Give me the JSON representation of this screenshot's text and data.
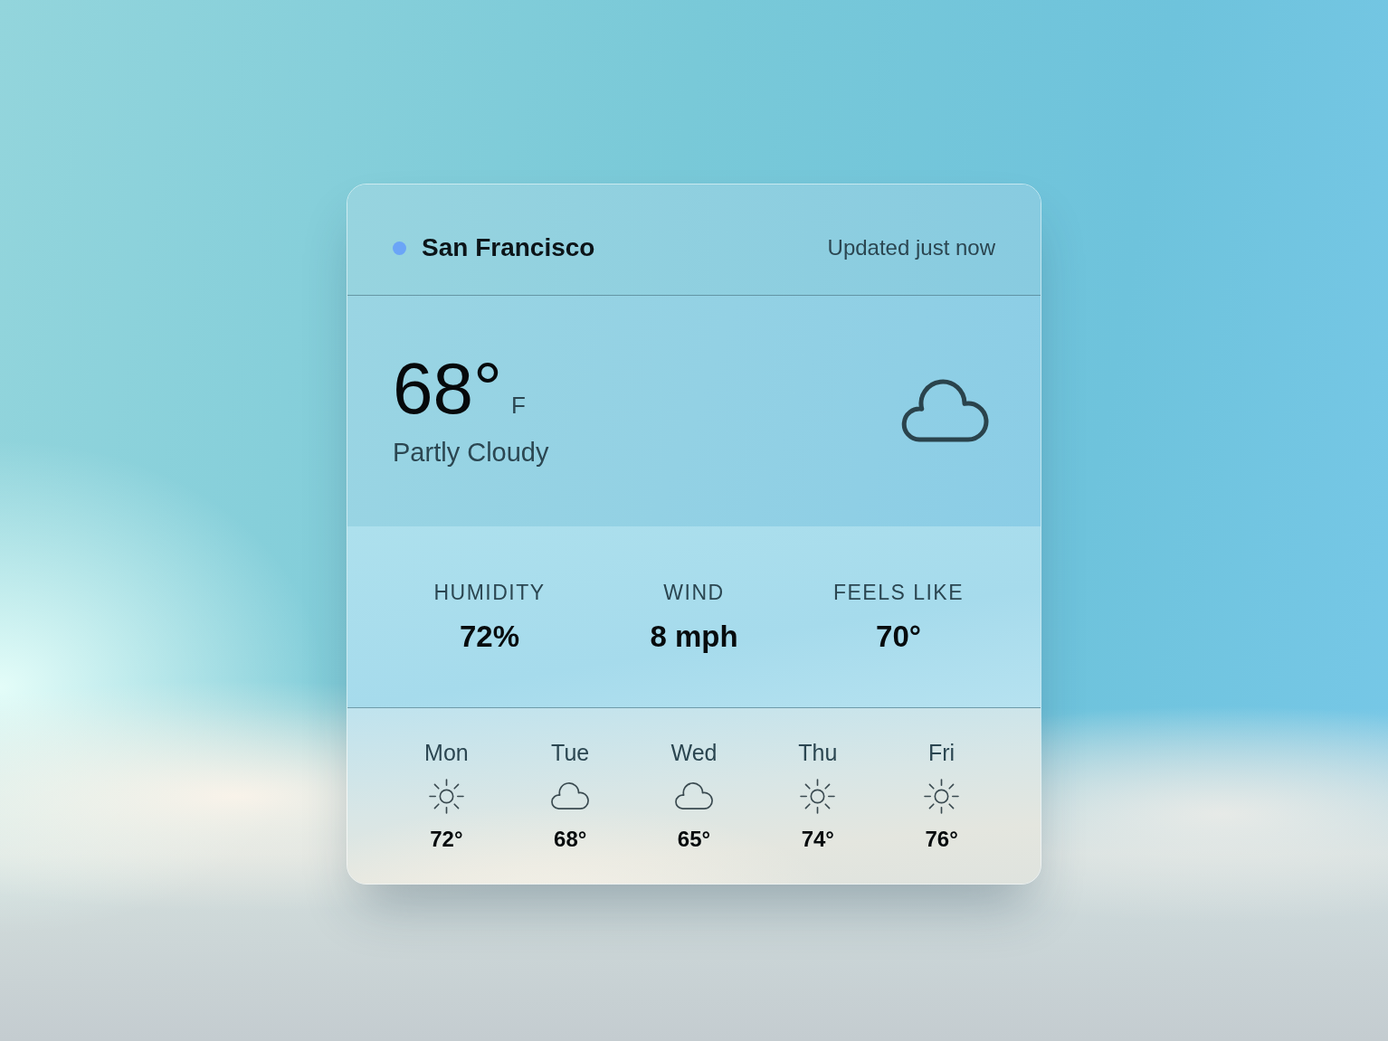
{
  "header": {
    "location": {
      "name": "San Francisco",
      "color": "#6ba5f7"
    },
    "updated": "Updated just now"
  },
  "current": {
    "temperature": "68°",
    "unit": "F",
    "condition": "Partly Cloudy",
    "kind": "cloudy"
  },
  "stats": [
    {
      "label": "HUMIDITY",
      "value": "72%"
    },
    {
      "label": "WIND",
      "value": "8 mph"
    },
    {
      "label": "FEELS LIKE",
      "value": "70°"
    }
  ],
  "forecast": [
    {
      "day": "Mon",
      "kind": "sunny",
      "temperature": "72°"
    },
    {
      "day": "Tue",
      "kind": "cloudy",
      "temperature": "68°"
    },
    {
      "day": "Wed",
      "kind": "cloudy",
      "temperature": "65°"
    },
    {
      "day": "Thu",
      "kind": "sunny",
      "temperature": "74°"
    },
    {
      "day": "Fri",
      "kind": "sunny",
      "temperature": "76°"
    }
  ]
}
